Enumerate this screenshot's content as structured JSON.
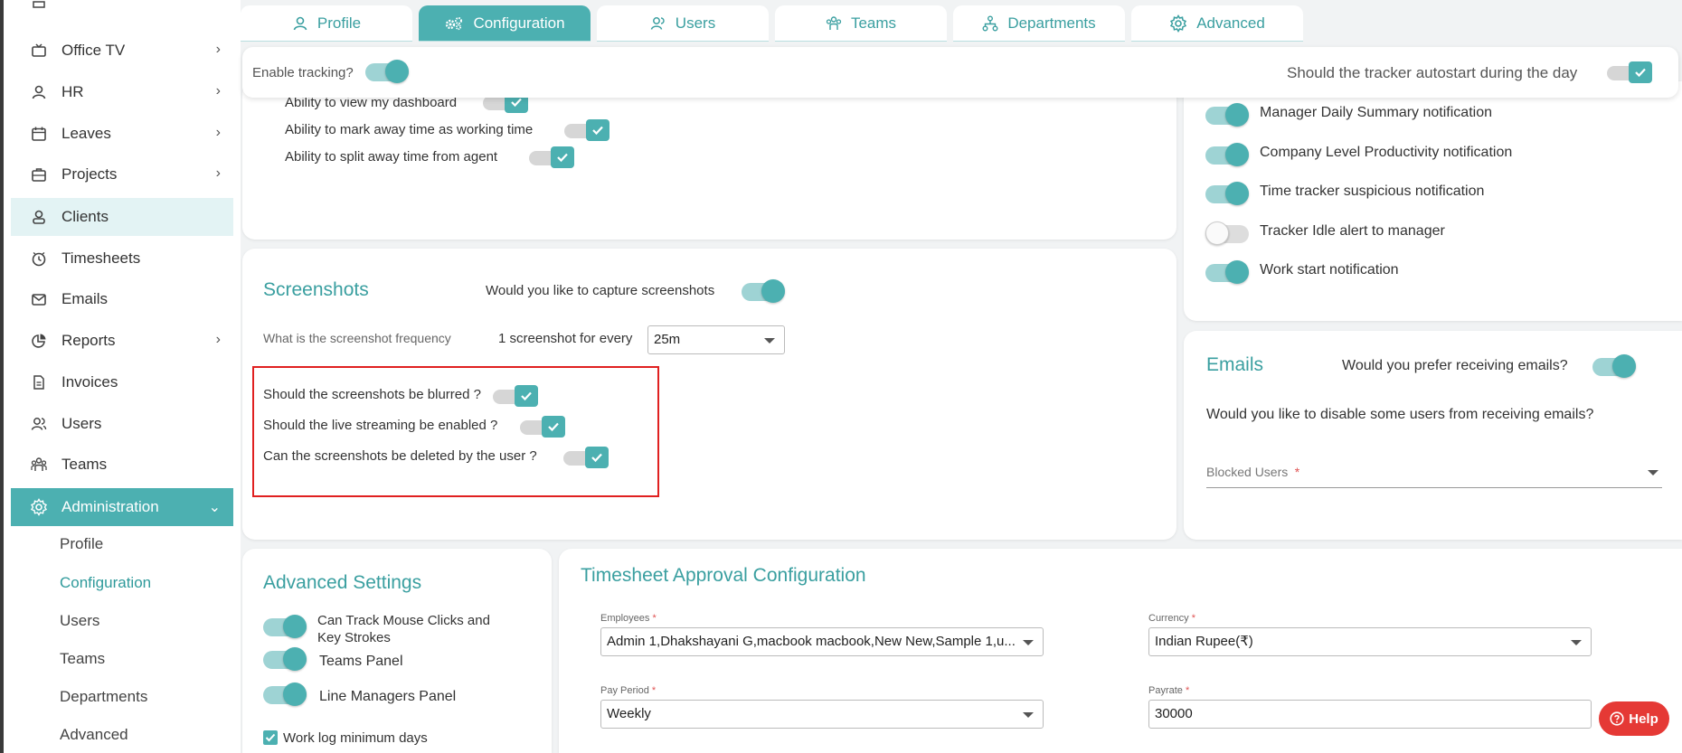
{
  "sidebar": {
    "items": [
      {
        "label": "Office TV",
        "icon": "tv-icon",
        "chevron": true
      },
      {
        "label": "HR",
        "icon": "user-icon",
        "chevron": true
      },
      {
        "label": "Leaves",
        "icon": "calendar-icon",
        "chevron": true
      },
      {
        "label": "Projects",
        "icon": "briefcase-icon",
        "chevron": true
      },
      {
        "label": "Clients",
        "icon": "client-icon",
        "chevron": false
      },
      {
        "label": "Timesheets",
        "icon": "clock-icon",
        "chevron": false
      },
      {
        "label": "Emails",
        "icon": "mail-icon",
        "chevron": false
      },
      {
        "label": "Reports",
        "icon": "pie-chart-icon",
        "chevron": true
      },
      {
        "label": "Invoices",
        "icon": "invoice-icon",
        "chevron": false
      },
      {
        "label": "Users",
        "icon": "users-icon",
        "chevron": false
      },
      {
        "label": "Teams",
        "icon": "teams-icon",
        "chevron": false
      },
      {
        "label": "Administration",
        "icon": "gear-icon",
        "chevron": true
      }
    ],
    "sub_items": [
      "Profile",
      "Configuration",
      "Users",
      "Teams",
      "Departments",
      "Advanced"
    ],
    "active_sub": "Configuration"
  },
  "tabs": [
    {
      "label": "Profile",
      "icon": "user-icon"
    },
    {
      "label": "Configuration",
      "icon": "gears-icon"
    },
    {
      "label": "Users",
      "icon": "users-icon"
    },
    {
      "label": "Teams",
      "icon": "teams-icon"
    },
    {
      "label": "Departments",
      "icon": "hierarchy-icon"
    },
    {
      "label": "Advanced",
      "icon": "advanced-gear-icon"
    }
  ],
  "tracking": {
    "enable_label": "Enable tracking?",
    "enable_on": true,
    "autostart_label": "Should the tracker autostart during the day",
    "autostart_checked": true
  },
  "top_card": {
    "rows": [
      {
        "label": "Ability to view my dashboard",
        "checked": true
      },
      {
        "label": "Ability to mark away time as working time",
        "checked": true
      },
      {
        "label": "Ability to split away time from agent",
        "checked": true
      }
    ]
  },
  "notifications": [
    {
      "label": "Manager Daily Summary notification",
      "on": true
    },
    {
      "label": "Company Level Productivity notification",
      "on": true
    },
    {
      "label": "Time tracker suspicious notification",
      "on": true
    },
    {
      "label": "Tracker Idle alert to manager",
      "on": false
    },
    {
      "label": "Work start notification",
      "on": true
    }
  ],
  "screenshots": {
    "title": "Screenshots",
    "capture_label": "Would you like to capture screenshots",
    "capture_on": true,
    "frequency_label": "What is the screenshot frequency",
    "frequency_prefix": "1 screenshot for every",
    "frequency_value": "25m",
    "options": [
      {
        "label": "Should the screenshots be blurred ?",
        "checked": true
      },
      {
        "label": "Should the live streaming be enabled ?",
        "checked": true
      },
      {
        "label": "Can the screenshots be deleted by the user ?",
        "checked": true
      }
    ]
  },
  "emails": {
    "title": "Emails",
    "prefer_label": "Would you prefer receiving emails?",
    "prefer_on": true,
    "disable_label": "Would you like to disable some users from receiving emails?",
    "blocked_label": "Blocked Users",
    "required_mark": "*"
  },
  "advanced": {
    "title": "Advanced Settings",
    "toggles": [
      {
        "label": "Can Track Mouse Clicks and Key Strokes",
        "on": true
      },
      {
        "label": "Teams Panel",
        "on": true
      },
      {
        "label": "Line Managers Panel",
        "on": true
      }
    ],
    "worklog_label": "Work log minimum days",
    "worklog_checked": true
  },
  "timesheet": {
    "title": "Timesheet Approval Configuration",
    "employees_label": "Employees",
    "employees_value": "Admin 1,Dhakshayani G,macbook macbook,New New,Sample 1,u...",
    "currency_label": "Currency",
    "currency_value": "Indian Rupee(₹)",
    "pay_period_label": "Pay Period",
    "pay_period_value": "Weekly",
    "payrate_label": "Payrate",
    "payrate_value": "30000",
    "required_mark": "*"
  },
  "help": {
    "label": "Help"
  },
  "colors": {
    "accent": "#4cb0b1",
    "accent_text": "#3a9fa0",
    "highlight": "#e02020",
    "help": "#e53935"
  }
}
